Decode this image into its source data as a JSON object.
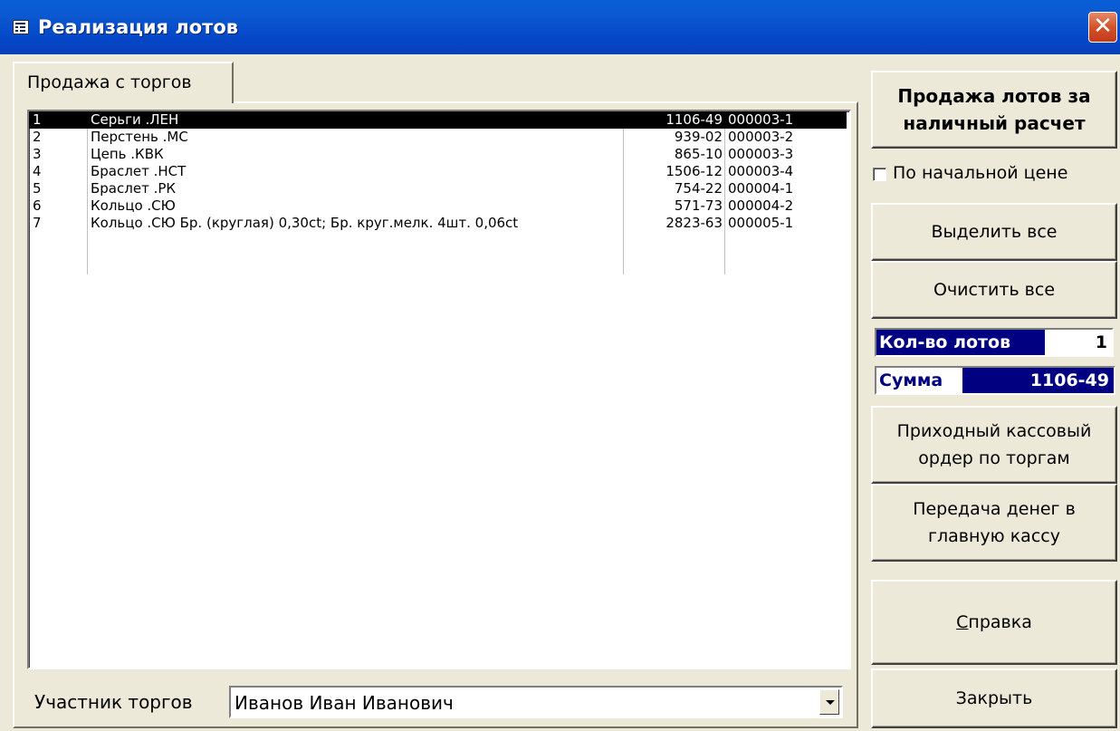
{
  "window": {
    "title": "Реализация лотов",
    "close_glyph": "✕"
  },
  "tabs": [
    {
      "label": "Продажа с торгов",
      "active": true
    }
  ],
  "lots": [
    {
      "num": "1",
      "name": "Серьги .ЛЕН",
      "price": "1106-49",
      "code": "000003-1",
      "selected": true
    },
    {
      "num": "2",
      "name": "Перстень .МС",
      "price": "939-02",
      "code": "000003-2",
      "selected": false
    },
    {
      "num": "3",
      "name": "Цепь .КВК",
      "price": "865-10",
      "code": "000003-3",
      "selected": false
    },
    {
      "num": "4",
      "name": "Браслет .НСТ",
      "price": "1506-12",
      "code": "000003-4",
      "selected": false
    },
    {
      "num": "5",
      "name": "Браслет .РК",
      "price": "754-22",
      "code": "000004-1",
      "selected": false
    },
    {
      "num": "6",
      "name": "Кольцо .СЮ",
      "price": "571-73",
      "code": "000004-2",
      "selected": false
    },
    {
      "num": "7",
      "name": "Кольцо .СЮ Бр. (круглая) 0,30ct; Бр. круг.мелк. 4шт. 0,06ct",
      "price": "2823-63",
      "code": "000005-1",
      "selected": false
    }
  ],
  "participant": {
    "label": "Участник торгов",
    "value": "Иванов Иван Иванович"
  },
  "sidebar": {
    "cash_sale_button": "Продажа лотов за наличный расчет",
    "initial_price_checkbox": {
      "label": "По начальной цене",
      "checked": false
    },
    "select_all_button": "Выделить все",
    "clear_all_button": "Очистить все",
    "lot_count": {
      "label": "Кол-во лотов",
      "value": "1"
    },
    "sum": {
      "label": "Сумма",
      "value": "1106-49"
    },
    "receipt_order_button": "Приходный кассовый ордер по торгам",
    "transfer_button": "Передача денег в главную кассу",
    "help_button": {
      "accel": "С",
      "rest": "правка"
    },
    "close_button": "Закрыть"
  },
  "colors": {
    "titlebar": "#0447c8",
    "face": "#ece9d8",
    "selection": "#000000",
    "counter_bg": "#000080"
  },
  "icons": {
    "app": "form-icon",
    "close": "close-icon",
    "dropdown": "chevron-down-icon"
  }
}
